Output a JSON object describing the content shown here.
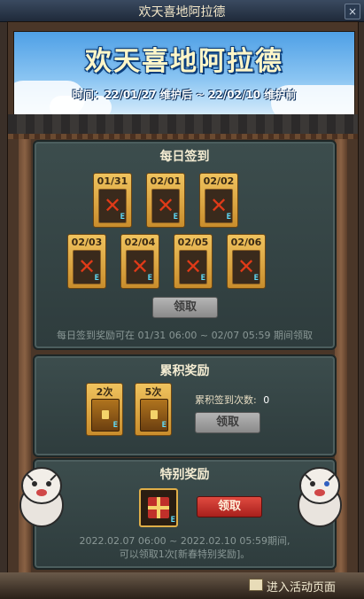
{
  "window": {
    "title": "欢天喜地阿拉德",
    "close_glyph": "×"
  },
  "banner": {
    "title": "欢天喜地阿拉德",
    "dates": "时间：22/01/27 维护后 ~ 22/02/10 维护前"
  },
  "daily": {
    "title": "每日签到",
    "days": [
      {
        "date": "01/31",
        "status": "missed"
      },
      {
        "date": "02/01",
        "status": "missed"
      },
      {
        "date": "02/02",
        "status": "missed"
      },
      {
        "date": "02/03",
        "status": "missed"
      },
      {
        "date": "02/04",
        "status": "missed"
      },
      {
        "date": "02/05",
        "status": "missed"
      },
      {
        "date": "02/06",
        "status": "missed"
      }
    ],
    "missed_mark": "✕",
    "claim_label": "领取",
    "note": "每日签到奖励可在 01/31 06:00 ~ 02/07 05:59 期间领取"
  },
  "cumulative": {
    "title": "累积奖励",
    "rewards": [
      {
        "count": "2次"
      },
      {
        "count": "5次"
      }
    ],
    "count_label": "累积签到次数:",
    "count_value": "0",
    "claim_label": "领取"
  },
  "special": {
    "title": "特别奖励",
    "claim_label": "领取",
    "note_line1": "2022.02.07 06:00 ~ 2022.02.10 05:59期间,",
    "note_line2": "可以领取1次[新春特别奖励]。"
  },
  "item_tag": "E",
  "footer": {
    "link_label": "进入活动页面"
  },
  "colors": {
    "accent_red": "#c0302a",
    "gold": "#e0ae48",
    "panel": "#34454a",
    "missed_red": "#e03a18"
  }
}
